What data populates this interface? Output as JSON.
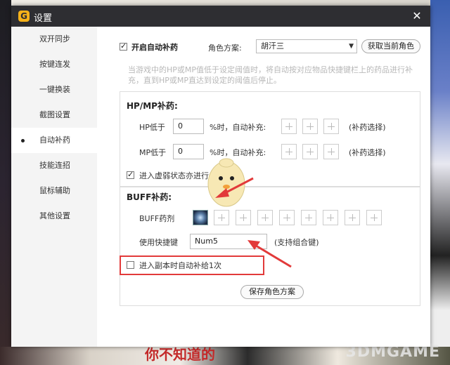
{
  "window": {
    "title": "设置",
    "app_icon": "G"
  },
  "sidebar": {
    "items": [
      {
        "label": "双开同步"
      },
      {
        "label": "按键连发"
      },
      {
        "label": "一键换装"
      },
      {
        "label": "截图设置"
      },
      {
        "label": "自动补药"
      },
      {
        "label": "技能连招"
      },
      {
        "label": "鼠标辅助"
      },
      {
        "label": "其他设置"
      }
    ],
    "active_index": 4
  },
  "auto_potion": {
    "enable_label": "开启自动补药",
    "enable_checked": true,
    "role_scheme_label": "角色方案:",
    "role_scheme_value": "胡汗三",
    "get_current_role_button": "获取当前角色",
    "description": "当游戏中的HP或MP值低于设定阈值时，将自动按对应物品快捷键栏上的药品进行补充，直到HP或MP直达到设定的阈值后停止。"
  },
  "hpmp": {
    "title": "HP/MP补药:",
    "hp_label": "HP低于",
    "hp_value": "0",
    "mp_label": "MP低于",
    "mp_value": "0",
    "percent_suffix": "%时，自动补充:",
    "select_hint": "(补药选择)",
    "weak_state_label": "进入虚弱状态亦进行自动补药",
    "weak_state_checked": true
  },
  "buff": {
    "title": "BUFF补药:",
    "potion_label": "BUFF药剂",
    "hotkey_label": "使用快捷键",
    "hotkey_value": "Num5",
    "combo_hint": "(支持组合键)",
    "dungeon_label": "进入副本时自动补给1次",
    "dungeon_checked": false
  },
  "save_button": "保存角色方案",
  "background": {
    "bottom_text": "你不知道的",
    "watermark": "3DMGAME"
  },
  "colors": {
    "highlight": "#e23a3a",
    "titlebar": "#2e2e32",
    "accent": "#f6b21a"
  }
}
